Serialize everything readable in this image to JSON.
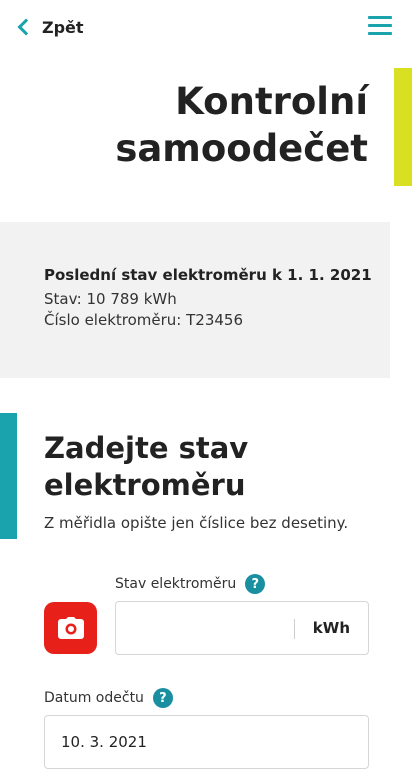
{
  "header": {
    "back_label": "Zpět",
    "back_icon": "chevron-left-icon",
    "menu_icon": "hamburger-menu-icon",
    "accent_color": "#1aa3ac"
  },
  "page": {
    "title": "Kontrolní samoodečet",
    "title_accent_color": "#d9e021"
  },
  "last_reading": {
    "heading": "Poslední stav elektroměru k 1. 1. 2021",
    "state": "Stav: 10 789 kWh",
    "meter_number": "Číslo elektroměru: T23456"
  },
  "entry": {
    "title": "Zadejte stav elektroměru",
    "subtitle": "Z měřidla opište jen číslice bez desetiny.",
    "meter_label": "Stav elektroměru",
    "meter_value": "",
    "meter_unit": "kWh",
    "help_glyph": "?",
    "camera_icon": "camera-icon",
    "camera_color": "#e8201a",
    "date_label": "Datum odečtu",
    "date_value": "10. 3. 2021"
  }
}
